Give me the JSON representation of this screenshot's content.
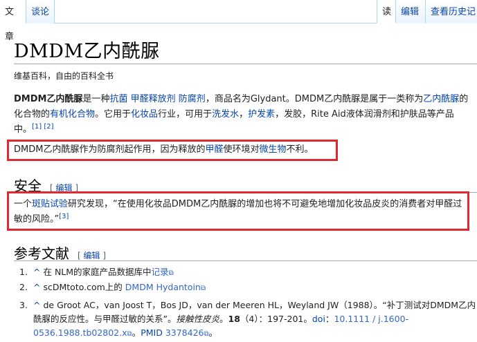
{
  "tabs": {
    "article": "文章",
    "talk": "谈论",
    "read": "读",
    "edit": "编辑",
    "history": "查看历史记"
  },
  "title": "DMDM乙内酰脲",
  "tagline": "维基百科，自由的百科全书",
  "intro": {
    "bold": "DMDM乙内酰脲",
    "t1": "是一种",
    "l_antibacterial": "抗菌",
    "l_formaldehyde_releaser": "甲醛释放剂",
    "l_preservative": "防腐剂",
    "t2": "，商品名为Glydant。DMDM乙内酰脲是属于一类称为",
    "l_hydantoin": "乙内酰脲",
    "t3": "的化合物的",
    "l_organic": "有机化合物",
    "t4": "。它用于",
    "l_cosmetics": "化妆品",
    "t5": "行业，可用于",
    "l_shampoo": "洗发水",
    "t6": "，",
    "l_hairgel": "护发素",
    "t7": "，发胶，Rite Aid液体润滑剂和护肤品等产品中。",
    "ref1": "[1]",
    "ref2": "[2]"
  },
  "box1": {
    "t1": "DMDM乙内酰脲作为防腐剂起作用，因为释放的",
    "l_formaldehyde": "甲醛",
    "t2": "使环境对",
    "l_microbe": "微生物",
    "t3": "不利。"
  },
  "safety": {
    "heading": "安全",
    "edit_open": "[",
    "edit": "编辑",
    "edit_close": "]",
    "t1": "一个",
    "l_patch": "斑贴试验",
    "t2": "研究发现，“在使用化妆品DMDM乙内酰脲的增加也将不可避免地增加化妆品皮炎的消费者对甲醛过敏的风险。”",
    "ref3": "[3]"
  },
  "references": {
    "heading": "参考文献",
    "edit_open": "[",
    "edit": "编辑",
    "edit_close": "]",
    "items": [
      {
        "caret": "^",
        "t1": "在 NLM的家庭产品数据库中",
        "link": "记录"
      },
      {
        "caret": "^",
        "t1": "scDMtoto.com上的 ",
        "link": "DMDM Hydantoin"
      },
      {
        "caret": "^",
        "t1": "de Groot AC，van Joost T，Bos JD，van der Meeren HL，Weyland JW（1988）。“补丁测试对DMDM乙内酰脲的反应性。与甲醛过敏的关系”。",
        "journal": "接触性皮炎",
        "t2": "。",
        "vol": "18",
        "t3": "（4）：197-201。",
        "doi_label": "doi",
        "doi_sep": "：",
        "doi": "10.1111 / j.1600-0536.1988.tb02802.x",
        "t4": "。",
        "pmid_label": "PMID",
        "pmid": "3378426",
        "t5": "。"
      }
    ]
  },
  "colors": {
    "link": "#0645ad",
    "highlight_box": "#e0282e",
    "tab_border": "#a7d7f9"
  }
}
